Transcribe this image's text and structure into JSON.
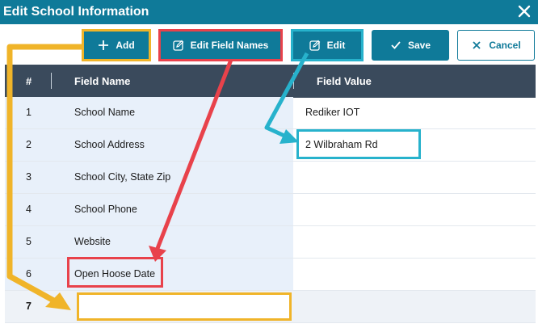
{
  "window": {
    "title": "Edit School Information"
  },
  "toolbar": {
    "add_label": "Add",
    "edit_field_names_label": "Edit Field Names",
    "edit_label": "Edit",
    "save_label": "Save",
    "cancel_label": "Cancel"
  },
  "table": {
    "columns": [
      "#",
      "Field Name",
      "Field Value"
    ],
    "rows": [
      {
        "num": "1",
        "name": "School Name",
        "value": "Rediker IOT"
      },
      {
        "num": "2",
        "name": "School Address",
        "value": "2 Wilbraham Rd"
      },
      {
        "num": "3",
        "name": "School City, State Zip",
        "value": ""
      },
      {
        "num": "4",
        "name": "School Phone",
        "value": ""
      },
      {
        "num": "5",
        "name": "Website",
        "value": ""
      },
      {
        "num": "6",
        "name": "Open Hoose Date",
        "value": ""
      },
      {
        "num": "7",
        "name": "",
        "value": ""
      }
    ]
  },
  "colors": {
    "primary": "#0f7a99",
    "header_bg": "#3a4a5c",
    "annotation_yellow": "#f0b429",
    "annotation_red": "#e8424b",
    "annotation_cyan": "#27b2cc"
  },
  "icons": {
    "close": "close-icon",
    "add": "plus-icon",
    "edit_field_names": "pencil-square-icon",
    "edit": "pencil-square-icon",
    "save": "checkmark-icon",
    "cancel": "x-icon"
  }
}
